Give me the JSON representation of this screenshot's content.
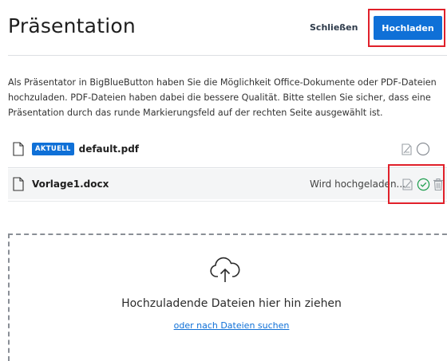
{
  "header": {
    "title": "Präsentation",
    "close_label": "Schließen",
    "upload_label": "Hochladen"
  },
  "description": "Als Präsentator in BigBlueButton haben Sie die Möglichkeit Office-Dokumente oder PDF-Dateien hochzuladen. PDF-Dateien haben dabei die bessere Qualität. Bitte stellen Sie sicher, dass eine Präsentation durch das runde Markierungsfeld auf der rechten Seite ausgewählt ist.",
  "files": [
    {
      "name": "default.pdf",
      "badge": "AKTUELL",
      "status": "",
      "icons": [
        "file-icon",
        "download-disabled-icon",
        "select-circle-icon"
      ]
    },
    {
      "name": "Vorlage1.docx",
      "badge": "",
      "status": "Wird hochgeladen...",
      "icons": [
        "file-icon",
        "download-disabled-icon",
        "check-circle-icon",
        "trash-icon"
      ]
    }
  ],
  "dropzone": {
    "text": "Hochzuladende Dateien hier hin ziehen",
    "link": "oder nach Dateien suchen",
    "icon": "cloud-upload-icon"
  },
  "colors": {
    "accent": "#0f70d7",
    "highlight": "#e0202a",
    "success": "#1f9e4f"
  }
}
